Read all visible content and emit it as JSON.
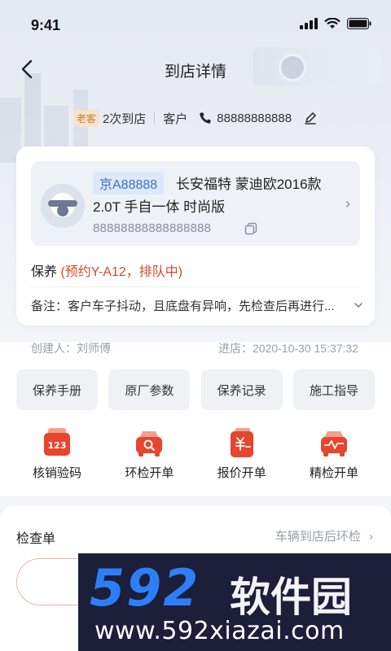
{
  "status_bar": {
    "time": "9:41"
  },
  "nav": {
    "title": "到店详情"
  },
  "customer": {
    "tag": "老客",
    "visits": "2次到店",
    "role": "客户",
    "phone": "88888888888"
  },
  "vehicle": {
    "plate": "京A88888",
    "model_line1": "长安福特 蒙迪欧2016款",
    "model_line2": "2.0T 手自一体 时尚版",
    "vin": "88888888888888888"
  },
  "service": {
    "type": "保养",
    "status": "(预约Y-A12，排队中)",
    "note": "备注：客户车子抖动，且底盘有异响，先检查后再进行..."
  },
  "meta": {
    "creator_label": "创建人：",
    "creator": "刘师傅",
    "arrival_label": "进店：",
    "arrival": "2020-10-30 15:37:32"
  },
  "quick_buttons": [
    "保养手册",
    "原厂参数",
    "保养记录",
    "施工指导"
  ],
  "actions": [
    {
      "label": "核销验码",
      "icon": "voucher-123-icon",
      "badge": "123"
    },
    {
      "label": "环检开单",
      "icon": "car-search-icon"
    },
    {
      "label": "报价开单",
      "icon": "yen-quote-icon"
    },
    {
      "label": "精检开单",
      "icon": "car-pulse-icon"
    }
  ],
  "inspection": {
    "title": "检查单",
    "link": "车辆到店后环检"
  },
  "watermark": {
    "number": "592",
    "chinese": "软件园",
    "url": "www.592xiazai.com"
  },
  "colors": {
    "accent": "#d44a2a",
    "plate_blue": "#3c74c7",
    "icon_red": "#e6452e"
  }
}
